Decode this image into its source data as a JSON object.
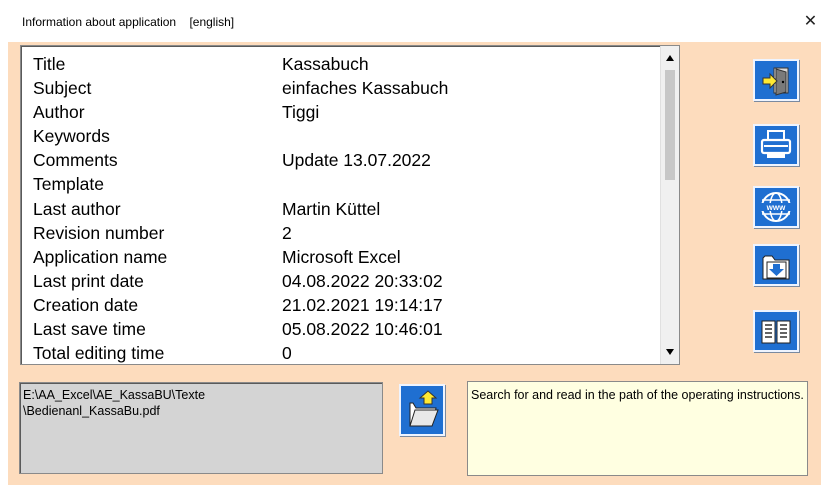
{
  "window": {
    "title": "Information about application    [english]",
    "close_glyph": "✕"
  },
  "properties": [
    {
      "label": "Title",
      "value": "Kassabuch"
    },
    {
      "label": "Subject",
      "value": "einfaches Kassabuch"
    },
    {
      "label": "Author",
      "value": "Tiggi"
    },
    {
      "label": "Keywords",
      "value": ""
    },
    {
      "label": "Comments",
      "value": "Update 13.07.2022"
    },
    {
      "label": "Template",
      "value": ""
    },
    {
      "label": "Last author",
      "value": "Martin Küttel"
    },
    {
      "label": "Revision number",
      "value": "2"
    },
    {
      "label": "Application name",
      "value": "Microsoft Excel"
    },
    {
      "label": "Last print date",
      "value": "04.08.2022 20:33:02"
    },
    {
      "label": "Creation date",
      "value": "21.02.2021 19:14:17"
    },
    {
      "label": "Last save time",
      "value": "05.08.2022 10:46:01"
    },
    {
      "label": "Total editing time",
      "value": "0"
    }
  ],
  "side_buttons": [
    {
      "icon": "exit-door-icon"
    },
    {
      "icon": "printer-icon"
    },
    {
      "icon": "www-globe-icon"
    },
    {
      "icon": "folder-download-icon"
    },
    {
      "icon": "open-book-icon"
    }
  ],
  "path": {
    "line1": "E:\\AA_Excel\\AE_KassaBU\\Texte",
    "line2": "\\Bedienanl_KassaBu.pdf"
  },
  "browse_button": {
    "icon": "open-folder-icon"
  },
  "info": {
    "text": "Search for and read in the path of the operating instructions."
  },
  "colors": {
    "background": "#fddcbd",
    "button": "#1f6fd1",
    "info_background": "#ffffe1",
    "path_background": "#d4d4d4"
  }
}
